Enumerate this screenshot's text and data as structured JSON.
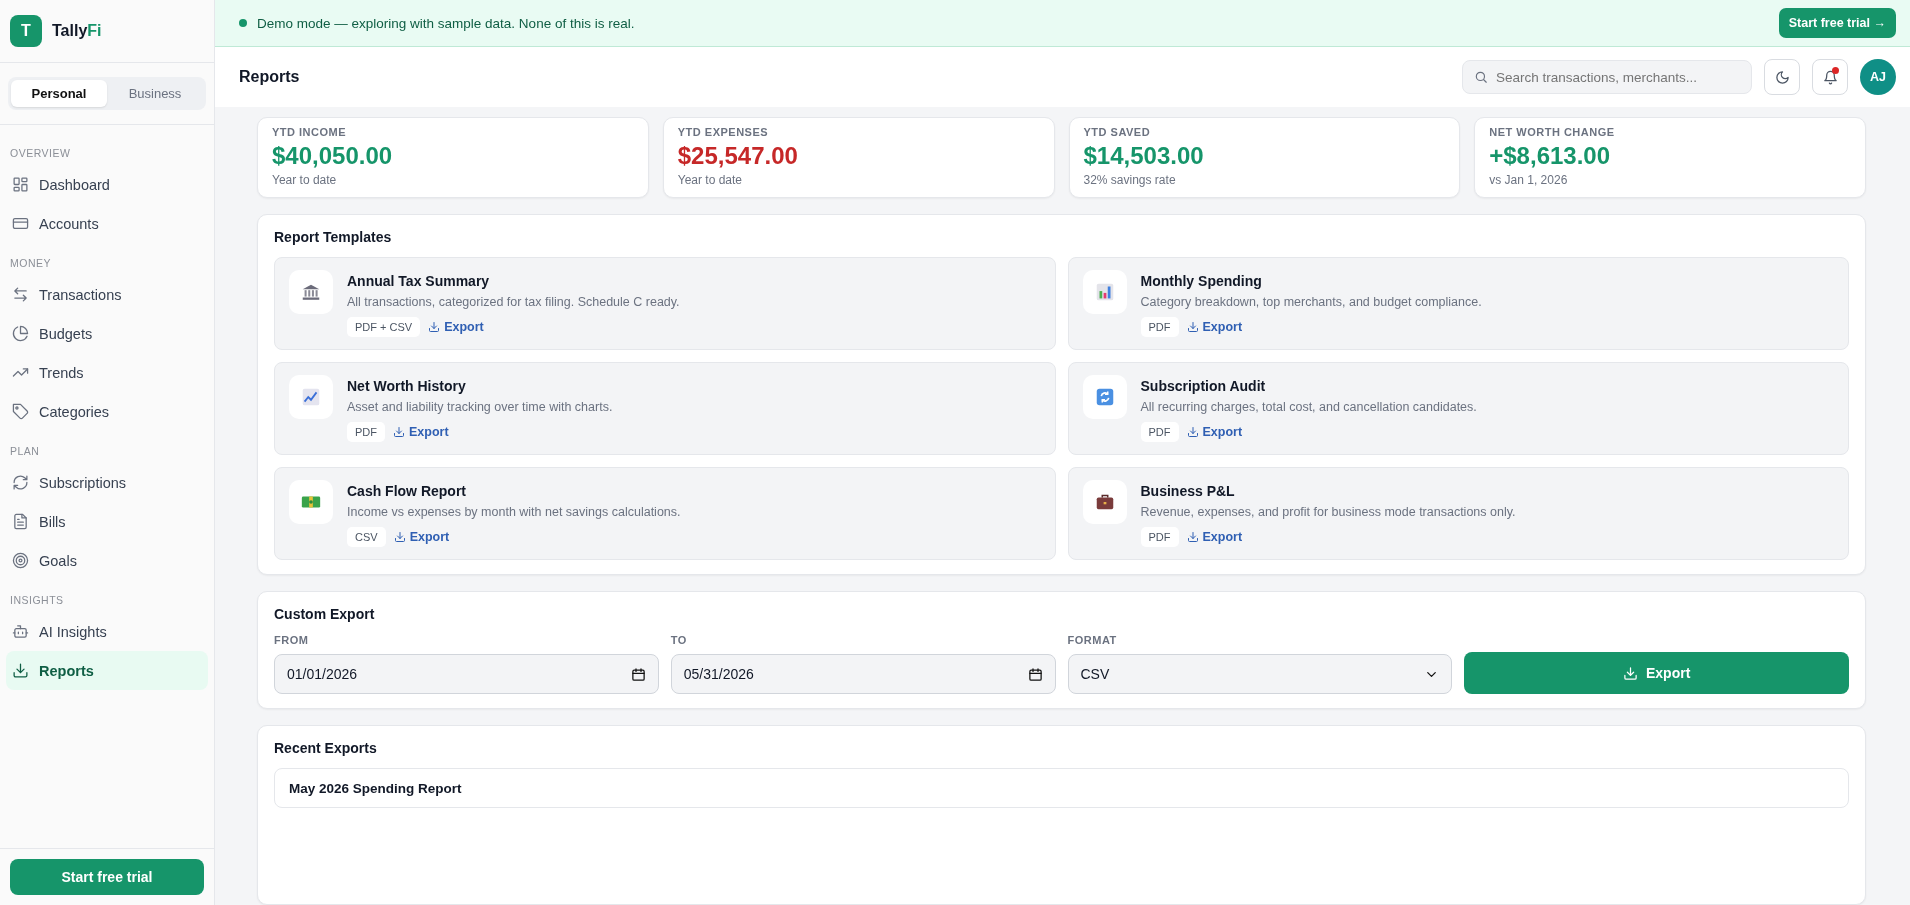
{
  "brand": {
    "logo_letter": "T",
    "name": "Tally",
    "name_accent": "Fi"
  },
  "mode_toggle": [
    {
      "label": "Personal",
      "selected": true
    },
    {
      "label": "Business",
      "selected": false
    }
  ],
  "sidebar": {
    "sections": [
      {
        "heading": "OVERVIEW",
        "items": [
          {
            "label": "Dashboard",
            "selected": false
          },
          {
            "label": "Accounts",
            "selected": false
          }
        ]
      },
      {
        "heading": "MONEY",
        "items": [
          {
            "label": "Transactions",
            "selected": false
          },
          {
            "label": "Budgets",
            "selected": false
          },
          {
            "label": "Trends",
            "selected": false
          },
          {
            "label": "Categories",
            "selected": false
          }
        ]
      },
      {
        "heading": "PLAN",
        "items": [
          {
            "label": "Subscriptions",
            "selected": false
          },
          {
            "label": "Bills",
            "selected": false
          },
          {
            "label": "Goals",
            "selected": false
          }
        ]
      },
      {
        "heading": "INSIGHTS",
        "items": [
          {
            "label": "AI Insights",
            "selected": false
          },
          {
            "label": "Reports",
            "selected": true
          }
        ]
      }
    ]
  },
  "sidebar_button": "Start free trial",
  "banner": {
    "message": "Demo mode — exploring with sample data. None of this is real.",
    "button": "Start free trial →"
  },
  "header": {
    "title": "Reports",
    "search": {
      "placeholder": "Search transactions, merchants..."
    },
    "notifications_unread": true,
    "avatar": "AJ"
  },
  "stats": [
    {
      "label": "YTD INCOME",
      "value": "$40,050.00",
      "color": "#16956a",
      "note": "Year to date"
    },
    {
      "label": "YTD EXPENSES",
      "value": "$25,547.00",
      "color": "#c62828",
      "note": "Year to date"
    },
    {
      "label": "YTD SAVED",
      "value": "$14,503.00",
      "color": "#16956a",
      "note": "32% savings rate"
    },
    {
      "label": "NET WORTH CHANGE",
      "value": "+$8,613.00",
      "color": "#16956a",
      "note": "vs Jan 1, 2026"
    }
  ],
  "templates": {
    "title": "Report Templates",
    "items": [
      {
        "title": "Annual Tax Summary",
        "description": "All transactions, categorized for tax filing. Schedule C ready.",
        "format": "PDF + CSV",
        "action": "Export"
      },
      {
        "title": "Monthly Spending",
        "description": "Category breakdown, top merchants, and budget compliance.",
        "format": "PDF",
        "action": "Export"
      },
      {
        "title": "Net Worth History",
        "description": "Asset and liability tracking over time with charts.",
        "format": "PDF",
        "action": "Export"
      },
      {
        "title": "Subscription Audit",
        "description": "All recurring charges, total cost, and cancellation candidates.",
        "format": "PDF",
        "action": "Export"
      },
      {
        "title": "Cash Flow Report",
        "description": "Income vs expenses by month with net savings calculations.",
        "format": "CSV",
        "action": "Export"
      },
      {
        "title": "Business P&L",
        "description": "Revenue, expenses, and profit for business mode transactions only.",
        "format": "PDF",
        "action": "Export"
      }
    ]
  },
  "custom_export": {
    "title": "Custom Export",
    "from": {
      "label": "FROM",
      "value": "01/01/2026"
    },
    "to": {
      "label": "TO",
      "value": "05/31/2026"
    },
    "format": {
      "label": "FORMAT",
      "value": "CSV"
    },
    "button": "Export"
  },
  "recent_exports": {
    "title": "Recent Exports",
    "items": [
      {
        "name": "May 2026 Spending Report"
      }
    ]
  }
}
